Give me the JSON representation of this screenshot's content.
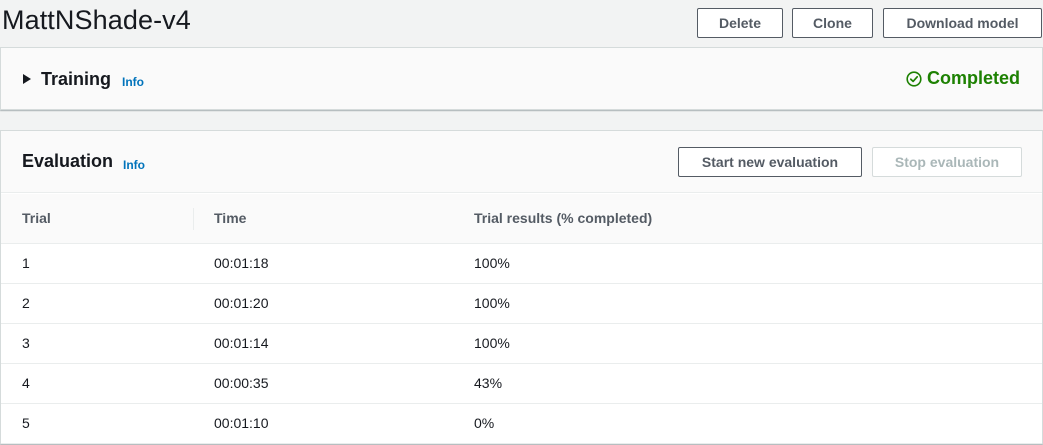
{
  "header": {
    "title": "MattNShade-v4",
    "delete_label": "Delete",
    "clone_label": "Clone",
    "download_label": "Download model"
  },
  "training": {
    "title": "Training",
    "info_label": "Info",
    "status_text": "Completed",
    "status_icon": "check-circle-icon",
    "status_color": "#1d8102",
    "expanded": false
  },
  "evaluation": {
    "title": "Evaluation",
    "info_label": "Info",
    "start_label": "Start new evaluation",
    "stop_label": "Stop evaluation",
    "columns": [
      "Trial",
      "Time",
      "Trial results (% completed)"
    ],
    "rows": [
      {
        "trial": "1",
        "time": "00:01:18",
        "result": "100%"
      },
      {
        "trial": "2",
        "time": "00:01:20",
        "result": "100%"
      },
      {
        "trial": "3",
        "time": "00:01:14",
        "result": "100%"
      },
      {
        "trial": "4",
        "time": "00:00:35",
        "result": "43%"
      },
      {
        "trial": "5",
        "time": "00:01:10",
        "result": "0%"
      }
    ]
  }
}
